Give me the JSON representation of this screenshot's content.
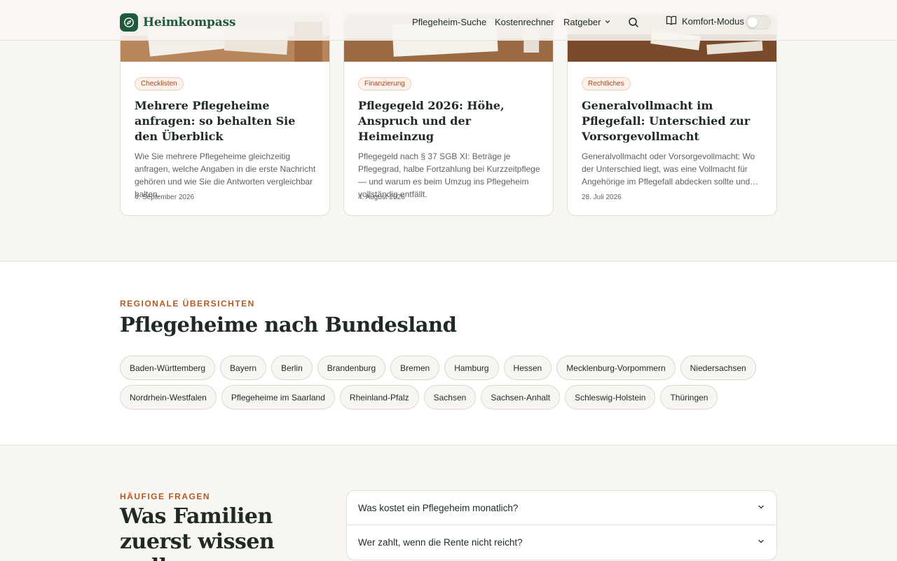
{
  "header": {
    "brand": "Heimkompass",
    "nav": {
      "search_label": "Pflegeheim-Suche",
      "calculator_label": "Kostenrechner",
      "guide_label": "Ratgeber"
    },
    "komfort_label": "Komfort-Modus",
    "komfort_on": false
  },
  "articles": [
    {
      "tag": "Checklisten",
      "title": "Mehrere Pflegeheime anfragen: so behalten Sie den Überblick",
      "excerpt": "Wie Sie mehrere Pflegeheime gleichzeitig anfragen, welche Angaben in die erste Nachricht gehören und wie Sie die Antworten vergleichbar halten.",
      "date": "4. September 2026"
    },
    {
      "tag": "Finanzierung",
      "title": "Pflegegeld 2026: Höhe, Anspruch und der Heimeinzug",
      "excerpt": "Pflegegeld nach § 37 SGB XI: Beträge je Pflegegrad, halbe Fortzahlung bei Kurzzeitpflege — und warum es beim Umzug ins Pflegeheim vollständig entfällt.",
      "date": "4. August 2026"
    },
    {
      "tag": "Rechtliches",
      "title": "Generalvollmacht im Pflegefall: Unterschied zur Vorsorgevollmacht",
      "excerpt": "Generalvollmacht oder Vorsorgevollmacht: Wo der Unterschied liegt, was eine Vollmacht für Angehörige im Pflegefall abdecken sollte und was sie nicht leisten kann.",
      "date": "28. Juli 2026"
    }
  ],
  "regional": {
    "eyebrow": "REGIONALE ÜBERSICHTEN",
    "title": "Pflegeheime nach Bundesland",
    "states": [
      "Baden-Württemberg",
      "Bayern",
      "Berlin",
      "Brandenburg",
      "Bremen",
      "Hamburg",
      "Hessen",
      "Mecklenburg-Vorpommern",
      "Niedersachsen",
      "Nordrhein-Westfalen",
      "Pflegeheime im Saarland",
      "Rheinland-Pfalz",
      "Sachsen",
      "Sachsen-Anhalt",
      "Schleswig-Holstein",
      "Thüringen"
    ]
  },
  "faq": {
    "eyebrow": "HÄUFIGE FRAGEN",
    "title": "Was Familien zuerst wissen wollen",
    "items": [
      "Was kostet ein Pflegeheim monatlich?",
      "Wer zahlt, wenn die Rente nicht reicht?"
    ]
  },
  "colors": {
    "brand": "#1f5a3a",
    "accent": "#b65a24",
    "background": "#f8f6f2"
  },
  "icons": [
    "compass-icon",
    "chevron-down-icon",
    "search-icon",
    "book-icon"
  ]
}
